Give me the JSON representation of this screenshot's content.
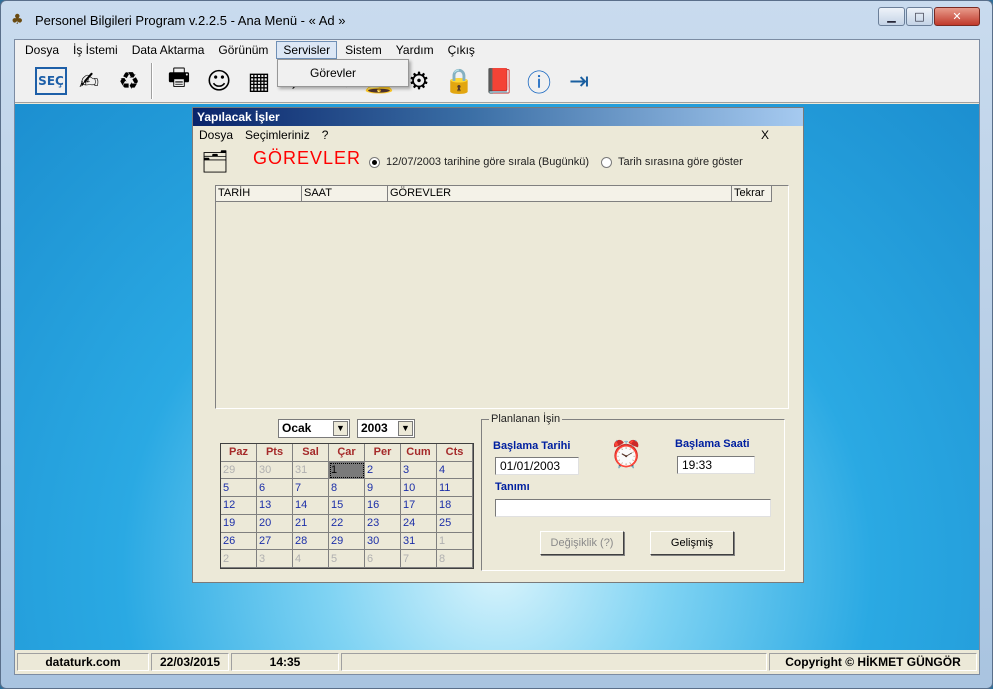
{
  "window": {
    "title": "Personel Bilgileri Program v.2.2.5  - Ana Menü - « Ad »"
  },
  "menubar": [
    "Dosya",
    "İş İstemi",
    "Data Aktarma",
    "Görünüm",
    "Servisler",
    "Sistem",
    "Yardım",
    "Çıkış"
  ],
  "menubar_active": "Servisler",
  "dropdown": {
    "item": "Görevler"
  },
  "toolbar": [
    "secin-icon",
    "write-icon",
    "recycle-icon",
    "printer-icon",
    "person-icon",
    "table-icon",
    "search-icon",
    "pen-icon",
    "bell-icon",
    "gears-icon",
    "lock-icon",
    "book-icon",
    "info-icon",
    "exit-icon"
  ],
  "dialog": {
    "title": "Yapılacak İşler",
    "menu": [
      "Dosya",
      "Seçimleriniz",
      "?"
    ],
    "close_label": "X",
    "header": "GÖREVLER",
    "radio1": "12/07/2003 tarihine göre sırala (Bugünkü)",
    "radio2": "Tarih sırasına göre  göster",
    "columns": [
      "TARİH",
      "SAAT",
      "GÖREVLER",
      "Tekrar"
    ]
  },
  "calendar": {
    "month": "Ocak",
    "year": "2003",
    "days_header": [
      "Paz",
      "Pts",
      "Sal",
      "Çar",
      "Per",
      "Cum",
      "Cts"
    ],
    "weeks": [
      [
        "29",
        "30",
        "31",
        "1",
        "2",
        "3",
        "4"
      ],
      [
        "5",
        "6",
        "7",
        "8",
        "9",
        "10",
        "11"
      ],
      [
        "12",
        "13",
        "14",
        "15",
        "16",
        "17",
        "18"
      ],
      [
        "19",
        "20",
        "21",
        "22",
        "23",
        "24",
        "25"
      ],
      [
        "26",
        "27",
        "28",
        "29",
        "30",
        "31",
        "1"
      ],
      [
        "2",
        "3",
        "4",
        "5",
        "6",
        "7",
        "8"
      ]
    ]
  },
  "plan": {
    "legend": "Planlanan İşin",
    "start_date_label": "Başlama Tarihi",
    "start_date": "01/01/2003",
    "start_time_label": "Başlama Saati",
    "start_time": "19:33",
    "desc_label": "Tanımı",
    "desc_value": "",
    "btn_change": "Değişiklik (?)",
    "btn_advanced": "Gelişmiş"
  },
  "status": {
    "site": "dataturk.com",
    "date": "22/03/2015",
    "time": "14:35",
    "copyright": "Copyright © HİKMET GÜNGÖR"
  }
}
